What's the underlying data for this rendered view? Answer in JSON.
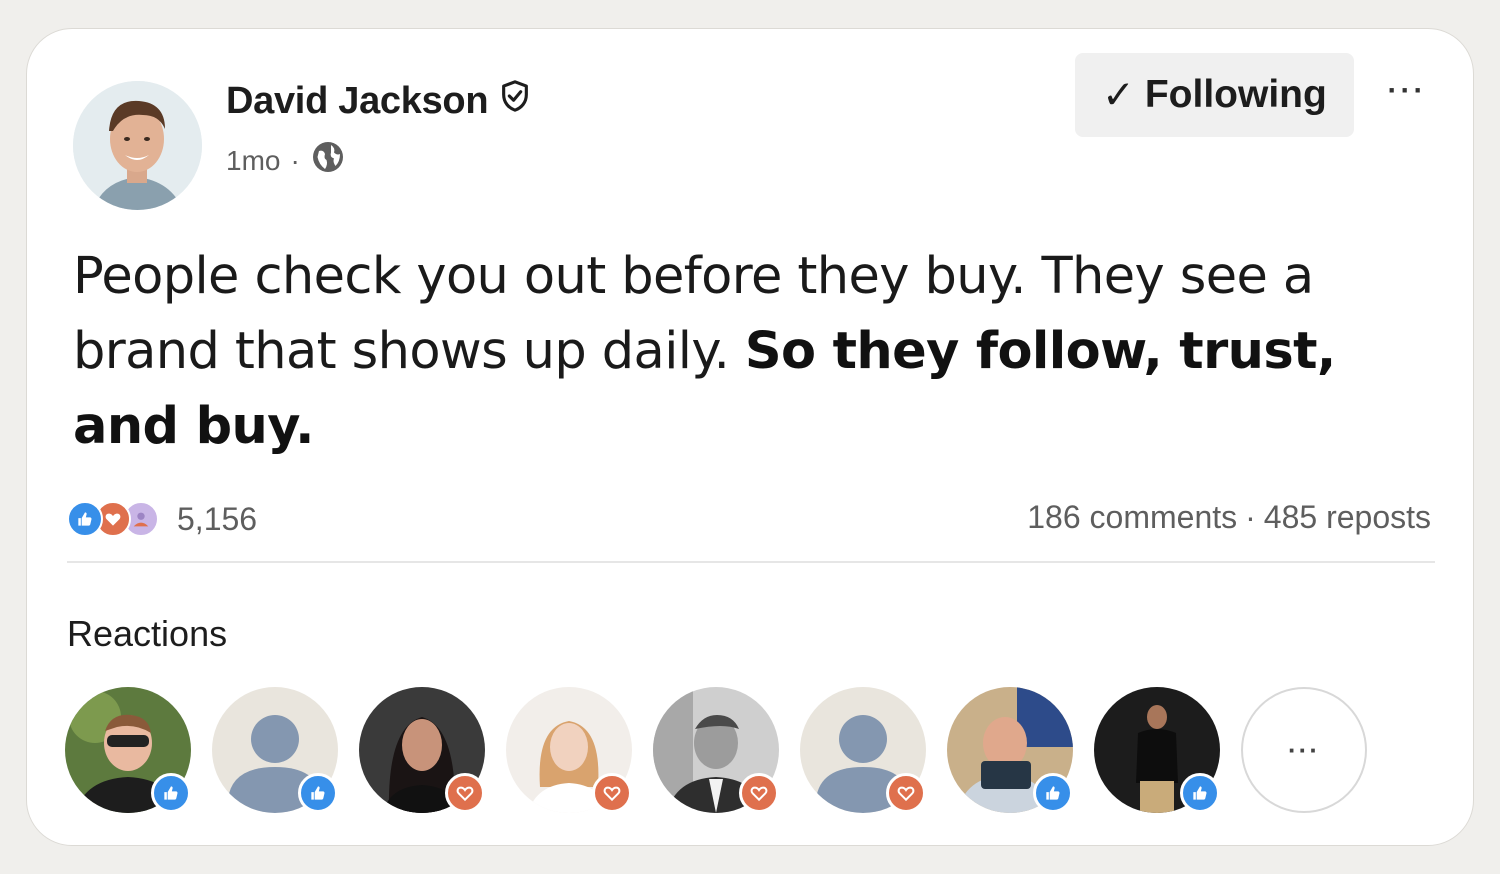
{
  "author": {
    "name": "David Jackson",
    "time_ago": "1mo",
    "separator": "·"
  },
  "follow_button": {
    "check": "✓",
    "label": "Following"
  },
  "more_menu": {
    "label": "···"
  },
  "post": {
    "text_regular": "People check you out before they buy. They see a brand that shows up daily. ",
    "text_bold": "So they follow, trust, and buy."
  },
  "engagement": {
    "reaction_count": "5,156",
    "comments": "186 comments",
    "separator": "·",
    "reposts": "485 reposts"
  },
  "reactions_section": {
    "heading": "Reactions",
    "more_label": "···",
    "reactors": [
      {
        "reaction": "like-icon",
        "avatar": "photo"
      },
      {
        "reaction": "like-icon",
        "avatar": "placeholder"
      },
      {
        "reaction": "love-icon",
        "avatar": "photo"
      },
      {
        "reaction": "love-icon",
        "avatar": "photo"
      },
      {
        "reaction": "love-icon",
        "avatar": "photo"
      },
      {
        "reaction": "love-icon",
        "avatar": "placeholder"
      },
      {
        "reaction": "like-icon",
        "avatar": "photo"
      },
      {
        "reaction": "like-icon",
        "avatar": "photo"
      }
    ]
  },
  "colors": {
    "like": "#378fe9",
    "love": "#df704d",
    "celebrate": "#9d84c4",
    "muted_text": "#5e5e5e",
    "button_bg": "#f0f0f0"
  }
}
